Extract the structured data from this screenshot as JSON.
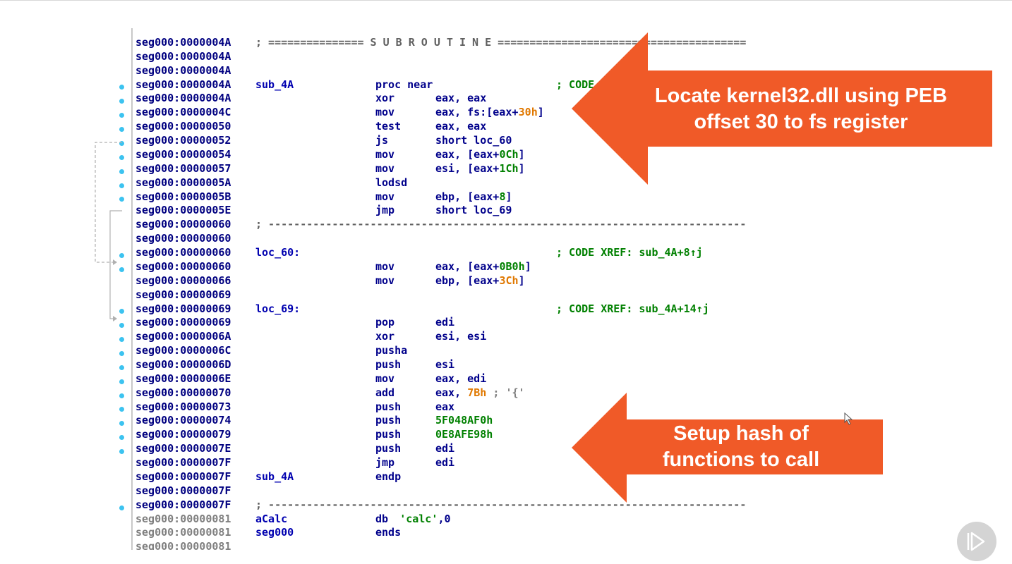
{
  "listing": {
    "lines": [
      {
        "addr": "seg000:0000004A",
        "label": "",
        "mnem": "",
        "op": "",
        "comment": "",
        "sep": "; =============== S U B R O U T I N E ======================================="
      },
      {
        "addr": "seg000:0000004A",
        "label": "",
        "mnem": "",
        "op": "",
        "comment": ""
      },
      {
        "addr": "seg000:0000004A",
        "label": "",
        "mnem": "",
        "op": "",
        "comment": ""
      },
      {
        "addr": "seg000:0000004A",
        "label": "sub_4A",
        "mnem": "proc near",
        "op": "",
        "comment": "; CODE"
      },
      {
        "addr": "seg000:0000004A",
        "label": "",
        "mnem": "xor",
        "op": "eax, eax",
        "comment": ""
      },
      {
        "addr": "seg000:0000004C",
        "label": "",
        "mnem": "mov",
        "op": "eax, fs:[eax+",
        "num": "30h",
        "op_tail": "]",
        "comment": ""
      },
      {
        "addr": "seg000:00000050",
        "label": "",
        "mnem": "test",
        "op": "eax, eax",
        "comment": ""
      },
      {
        "addr": "seg000:00000052",
        "label": "",
        "mnem": "js",
        "op": "short loc_60",
        "comment": ""
      },
      {
        "addr": "seg000:00000054",
        "label": "",
        "mnem": "mov",
        "op": "eax, [eax+",
        "greennum": "0Ch",
        "op_tail": "]",
        "comment": ""
      },
      {
        "addr": "seg000:00000057",
        "label": "",
        "mnem": "mov",
        "op": "esi, [eax+",
        "greennum": "1Ch",
        "op_tail": "]",
        "comment": ""
      },
      {
        "addr": "seg000:0000005A",
        "label": "",
        "mnem": "lodsd",
        "op": "",
        "comment": ""
      },
      {
        "addr": "seg000:0000005B",
        "label": "",
        "mnem": "mov",
        "op": "ebp, [eax+",
        "greennum": "8",
        "op_tail": "]",
        "comment": ""
      },
      {
        "addr": "seg000:0000005E",
        "label": "",
        "mnem": "jmp",
        "op": "short loc_69",
        "comment": ""
      },
      {
        "addr": "seg000:00000060",
        "label": "",
        "mnem": "",
        "op": "",
        "comment": "",
        "sep": "; ---------------------------------------------------------------------------"
      },
      {
        "addr": "seg000:00000060",
        "label": "",
        "mnem": "",
        "op": "",
        "comment": ""
      },
      {
        "addr": "seg000:00000060",
        "label": "loc_60:",
        "mnem": "",
        "op": "",
        "comment": "; CODE XREF: sub_4A+8↑j"
      },
      {
        "addr": "seg000:00000060",
        "label": "",
        "mnem": "mov",
        "op": "eax, [eax+",
        "greennum": "0B0h",
        "op_tail": "]",
        "comment": ""
      },
      {
        "addr": "seg000:00000066",
        "label": "",
        "mnem": "mov",
        "op": "ebp, [eax+",
        "num": "3Ch",
        "op_tail": "]",
        "comment": ""
      },
      {
        "addr": "seg000:00000069",
        "label": "",
        "mnem": "",
        "op": "",
        "comment": ""
      },
      {
        "addr": "seg000:00000069",
        "label": "loc_69:",
        "mnem": "",
        "op": "",
        "comment": "; CODE XREF: sub_4A+14↑j"
      },
      {
        "addr": "seg000:00000069",
        "label": "",
        "mnem": "pop",
        "op": "edi",
        "comment": ""
      },
      {
        "addr": "seg000:0000006A",
        "label": "",
        "mnem": "xor",
        "op": "esi, esi",
        "comment": ""
      },
      {
        "addr": "seg000:0000006C",
        "label": "",
        "mnem": "pusha",
        "op": "",
        "comment": ""
      },
      {
        "addr": "seg000:0000006D",
        "label": "",
        "mnem": "push",
        "op": "esi",
        "comment": ""
      },
      {
        "addr": "seg000:0000006E",
        "label": "",
        "mnem": "mov",
        "op": "eax, edi",
        "comment": ""
      },
      {
        "addr": "seg000:00000070",
        "label": "",
        "mnem": "add",
        "op": "eax, ",
        "num": "7Bh",
        "op_tail": " ; '{'",
        "comment": ""
      },
      {
        "addr": "seg000:00000073",
        "label": "",
        "mnem": "push",
        "op": "eax",
        "comment": ""
      },
      {
        "addr": "seg000:00000074",
        "label": "",
        "mnem": "push",
        "op": "",
        "greennum": "5F048AF0h",
        "comment": ""
      },
      {
        "addr": "seg000:00000079",
        "label": "",
        "mnem": "push",
        "op": "",
        "greennum": "0E8AFE98h",
        "comment": ""
      },
      {
        "addr": "seg000:0000007E",
        "label": "",
        "mnem": "push",
        "op": "edi",
        "comment": ""
      },
      {
        "addr": "seg000:0000007F",
        "label": "",
        "mnem": "jmp",
        "op": "edi",
        "comment": ""
      },
      {
        "addr": "seg000:0000007F",
        "label": "sub_4A",
        "mnem": "endp",
        "op": "",
        "comment": ""
      },
      {
        "addr": "seg000:0000007F",
        "label": "",
        "mnem": "",
        "op": "",
        "comment": ""
      },
      {
        "addr": "seg000:0000007F",
        "label": "",
        "mnem": "",
        "op": "",
        "comment": "",
        "sep": "; ---------------------------------------------------------------------------"
      },
      {
        "addr": "seg000:00000081",
        "label": "aCalc",
        "mnem": "db",
        "op": "",
        "str": "'calc'",
        "op_tail": ",0",
        "comment": "",
        "gray": true
      },
      {
        "addr": "seg000:00000081",
        "label": "seg000",
        "mnem": "ends",
        "op": "",
        "comment": "",
        "gray": true
      },
      {
        "addr": "seg000:00000081",
        "label": "",
        "mnem": "",
        "op": "",
        "comment": "",
        "gray": true
      }
    ]
  },
  "callouts": [
    {
      "text_line1": "Locate kernel32.dll using PEB",
      "text_line2": "offset 30 to fs register",
      "color": "#f05a28"
    },
    {
      "text_line1": "Setup hash of",
      "text_line2": "functions to call",
      "color": "#f05a28"
    }
  ],
  "colors": {
    "accent": "#f05a28",
    "dot": "#3cc3f0"
  }
}
